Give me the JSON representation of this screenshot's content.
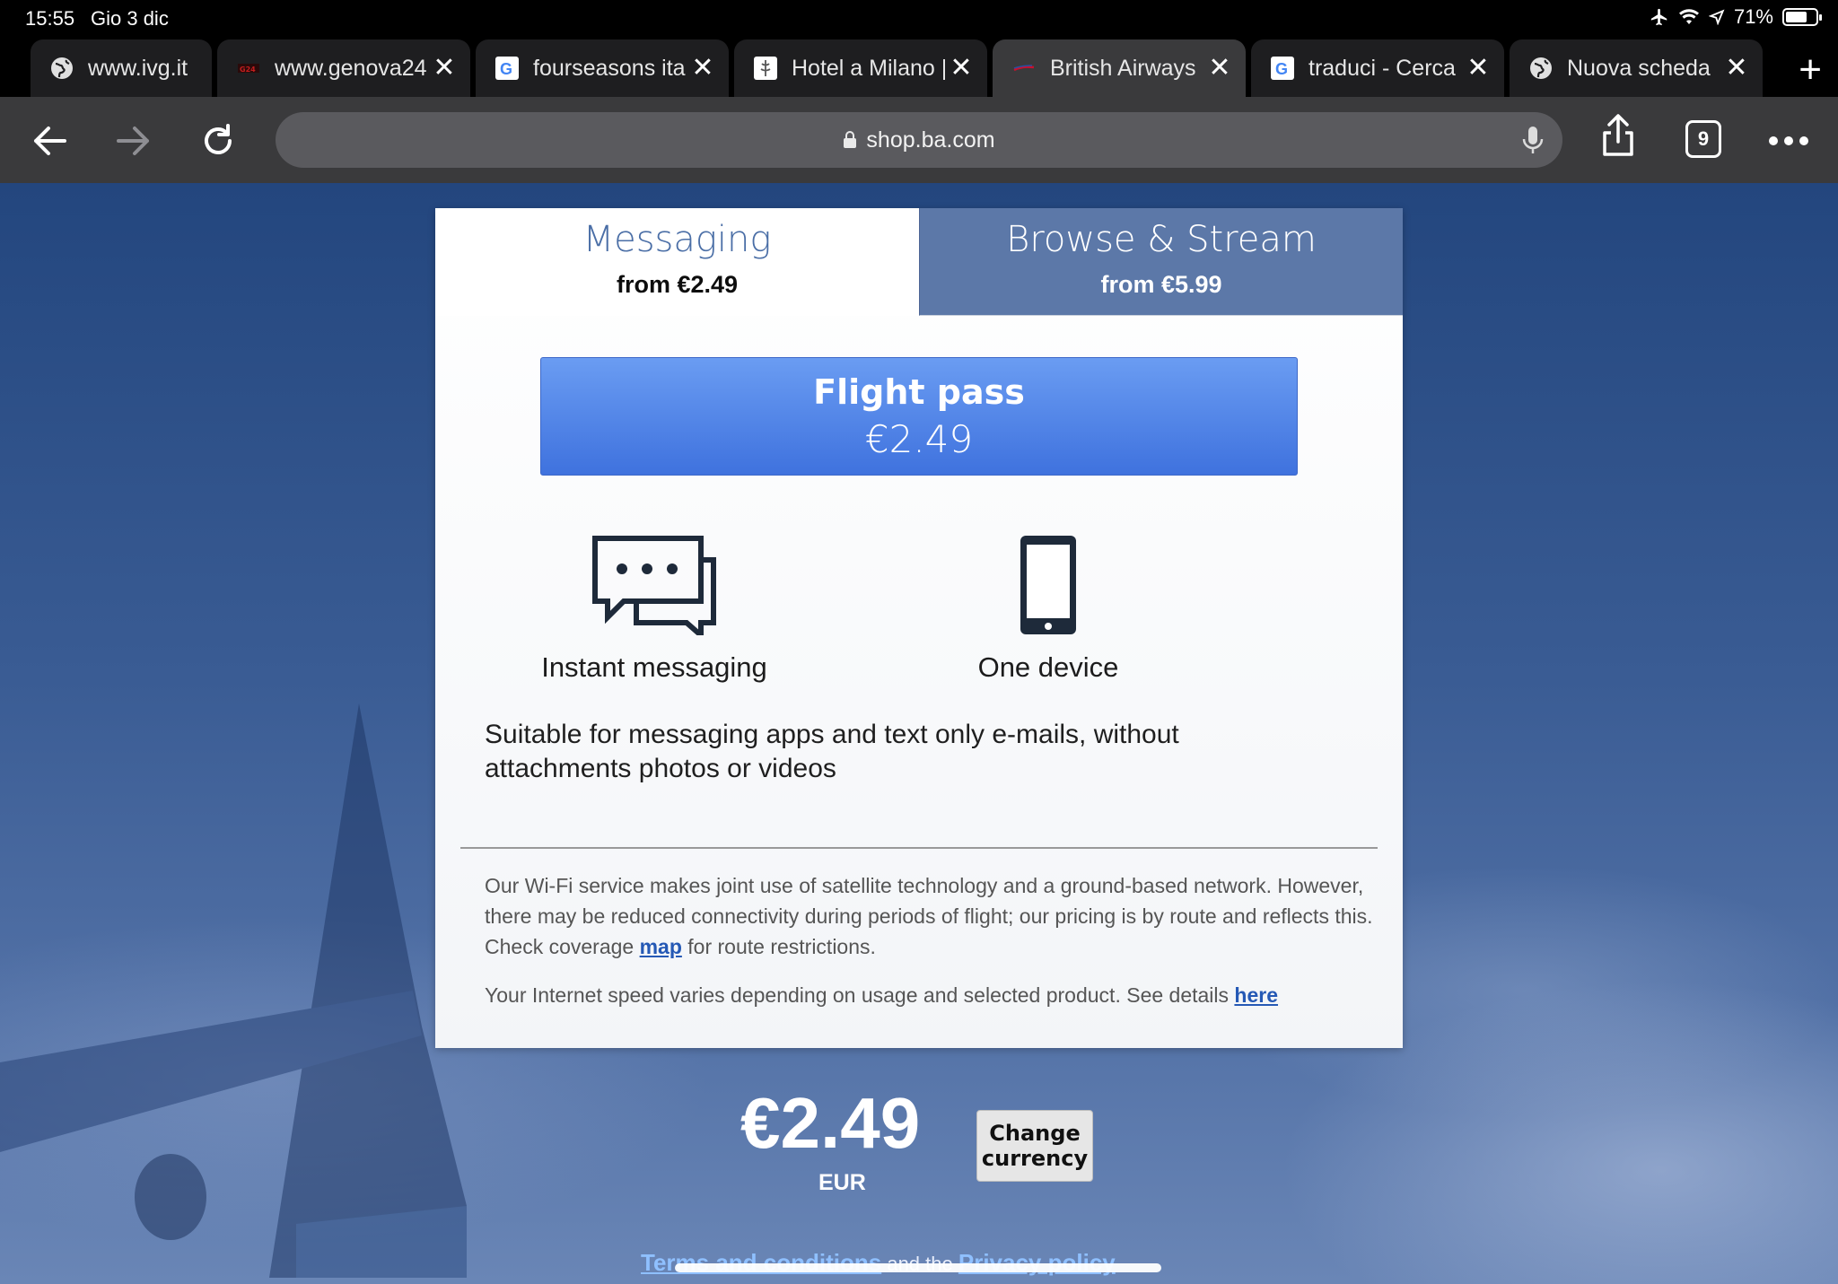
{
  "status_bar": {
    "time": "15:55",
    "date": "Gio 3 dic",
    "battery": "71%",
    "battery_level": 0.71
  },
  "tabs": [
    {
      "title": "www.ivg.it",
      "favicon": "globe-icon"
    },
    {
      "title": "www.genova24",
      "favicon": "genova24-favicon"
    },
    {
      "title": "fourseasons ita",
      "favicon": "google-icon"
    },
    {
      "title": "Hotel a Milano |",
      "favicon": "hotel-favicon"
    },
    {
      "title": "British Airways",
      "favicon": "british-airways-favicon"
    },
    {
      "title": "traduci - Cerca",
      "favicon": "google-icon"
    },
    {
      "title": "Nuova scheda",
      "favicon": "globe-icon"
    }
  ],
  "toolbar": {
    "url": "shop.ba.com",
    "tab_count": "9"
  },
  "plans": {
    "messaging": {
      "name": "Messaging",
      "price": "from €2.49"
    },
    "browse": {
      "name": "Browse & Stream",
      "price": "from €5.99"
    }
  },
  "flight_pass": {
    "label": "Flight pass",
    "price": "€2.49"
  },
  "features": {
    "messaging": "Instant messaging",
    "device": "One device"
  },
  "description": "Suitable for messaging apps and text only e-mails, without attachments photos or videos",
  "info": {
    "text_before": "Our Wi-Fi service makes joint use of satellite technology and a ground-based network. However, there may be reduced connectivity during periods of flight; our pricing is by route and reflects this. Check coverage ",
    "map_link": "map",
    "text_after": " for route restrictions.",
    "speed_text": "Your Internet speed varies depending on usage and selected product. See details ",
    "here_link": "here"
  },
  "total": {
    "price": "€2.49",
    "currency": "EUR",
    "change_currency": "Change currency"
  },
  "footer": {
    "terms": "Terms and conditions",
    "and": " and the ",
    "privacy": "Privacy policy"
  },
  "colors": {
    "tab_active_text": "#4a6ea6",
    "flight_pass_blue": "#4a7fe6",
    "link_blue": "#2559b5"
  }
}
